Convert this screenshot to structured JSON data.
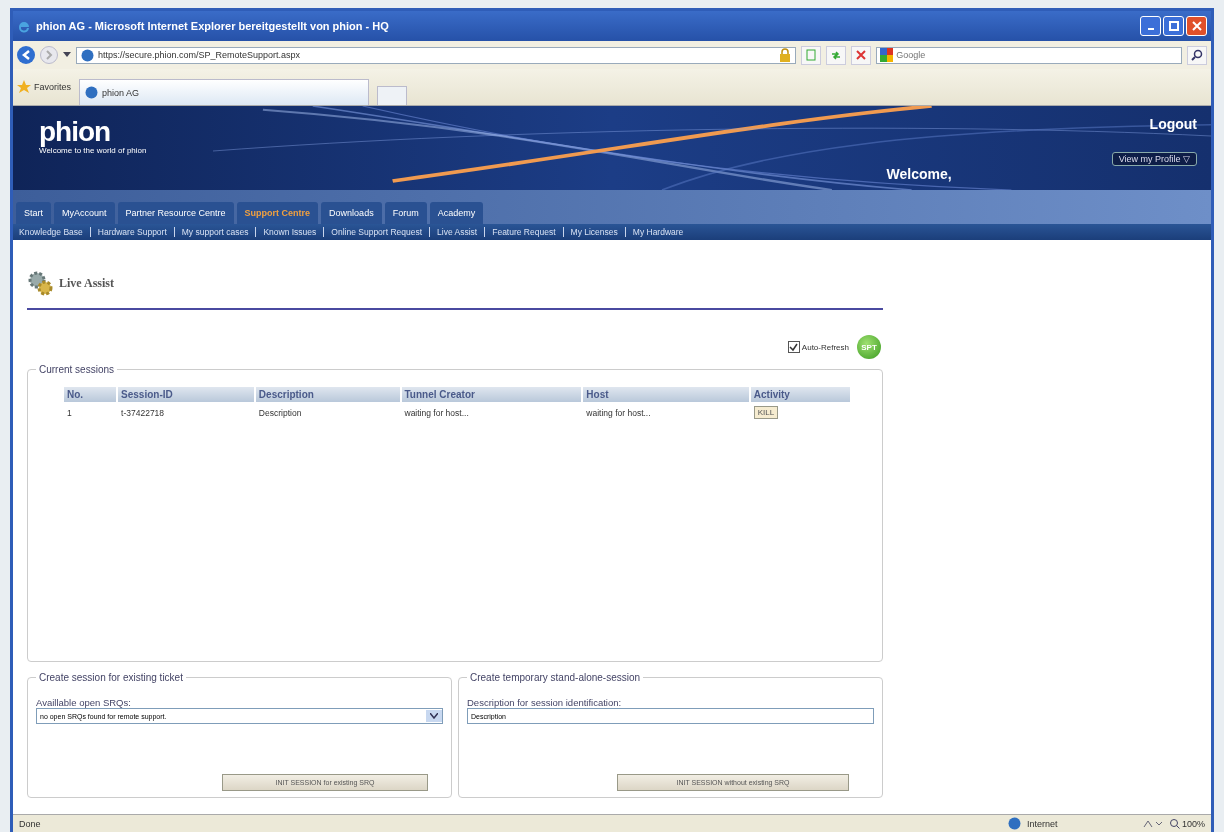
{
  "window": {
    "title": "phion AG - Microsoft Internet Explorer bereitgestellt von phion - HQ"
  },
  "address_bar": {
    "value": "https://secure.phion.com/SP_RemoteSupport.aspx"
  },
  "search": {
    "placeholder": "Google"
  },
  "favorites": {
    "label": "Favorites",
    "tabs": [
      {
        "label": "phion AG",
        "selected": true
      }
    ]
  },
  "header": {
    "logo": "phion",
    "tagline": "Welcome to the world of phion",
    "logout": "Logout",
    "welcome": "Welcome,",
    "profile_button": "View my Profile ▽"
  },
  "nav_tabs": [
    {
      "label": "Start",
      "selected": false
    },
    {
      "label": "MyAccount",
      "selected": false
    },
    {
      "label": "Partner Resource Centre",
      "selected": false
    },
    {
      "label": "Support Centre",
      "selected": true
    },
    {
      "label": "Downloads",
      "selected": false
    },
    {
      "label": "Forum",
      "selected": false
    },
    {
      "label": "Academy",
      "selected": false
    }
  ],
  "sub_nav": [
    "Knowledge Base",
    "Hardware Support",
    "My support cases",
    "Known Issues",
    "Online Support Request",
    "Live Assist",
    "Feature Request",
    "My Licenses",
    "My Hardware"
  ],
  "page": {
    "title": "Live Assist",
    "auto_refresh": {
      "label": "Auto-Refresh",
      "checked": true
    },
    "refresh_badge": "SPT"
  },
  "current_sessions": {
    "legend": "Current sessions",
    "columns": [
      "No.",
      "Session-ID",
      "Description",
      "Tunnel Creator",
      "Host",
      "Activity"
    ],
    "rows": [
      {
        "cells": [
          "1",
          "t-37422718",
          "Description",
          "waiting for host...",
          "waiting for host..."
        ],
        "action": "KILL"
      }
    ]
  },
  "existing_ticket": {
    "legend": "Create session for existing ticket",
    "field_label": "Availlable open SRQs:",
    "select_value": "no open SRQs found for remote support.",
    "button": "INIT SESSION for existing SRQ"
  },
  "standalone": {
    "legend": "Create temporary stand-alone-session",
    "field_label": "Description for session identification:",
    "input_value": "Description",
    "button": "INIT SESSION without existing SRQ"
  },
  "status_bar": {
    "text": "Done",
    "zone": "Internet",
    "zoom": "100%"
  }
}
